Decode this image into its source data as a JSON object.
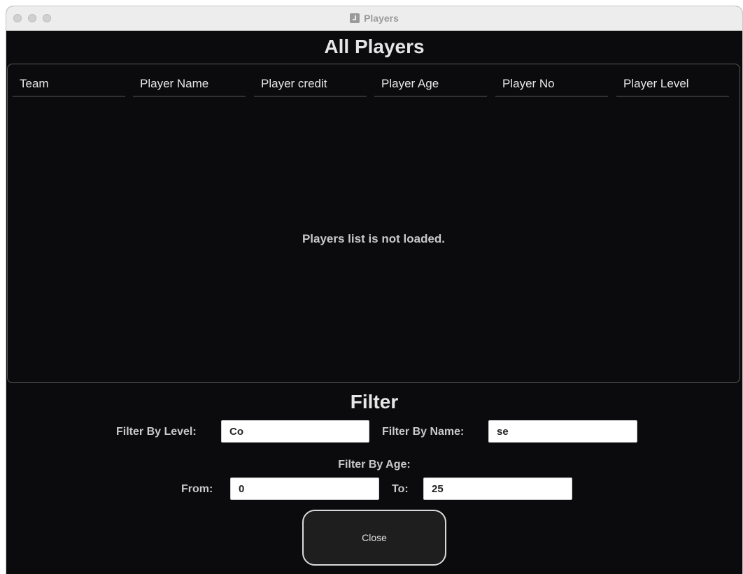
{
  "window": {
    "title": "Players"
  },
  "main": {
    "heading": "All Players",
    "table": {
      "columns": [
        "Team",
        "Player Name",
        "Player credit",
        "Player Age",
        "Player No",
        "Player Level"
      ],
      "empty_message": "Players list is not loaded."
    }
  },
  "filter": {
    "heading": "Filter",
    "level": {
      "label": "Filter By Level:",
      "value": "Co"
    },
    "name": {
      "label": "Filter By Name:",
      "value": "se"
    },
    "age": {
      "label": "Filter By Age:",
      "from_label": "From:",
      "from_value": "0",
      "to_label": "To:",
      "to_value": "25"
    }
  },
  "buttons": {
    "close_label": "Close"
  }
}
